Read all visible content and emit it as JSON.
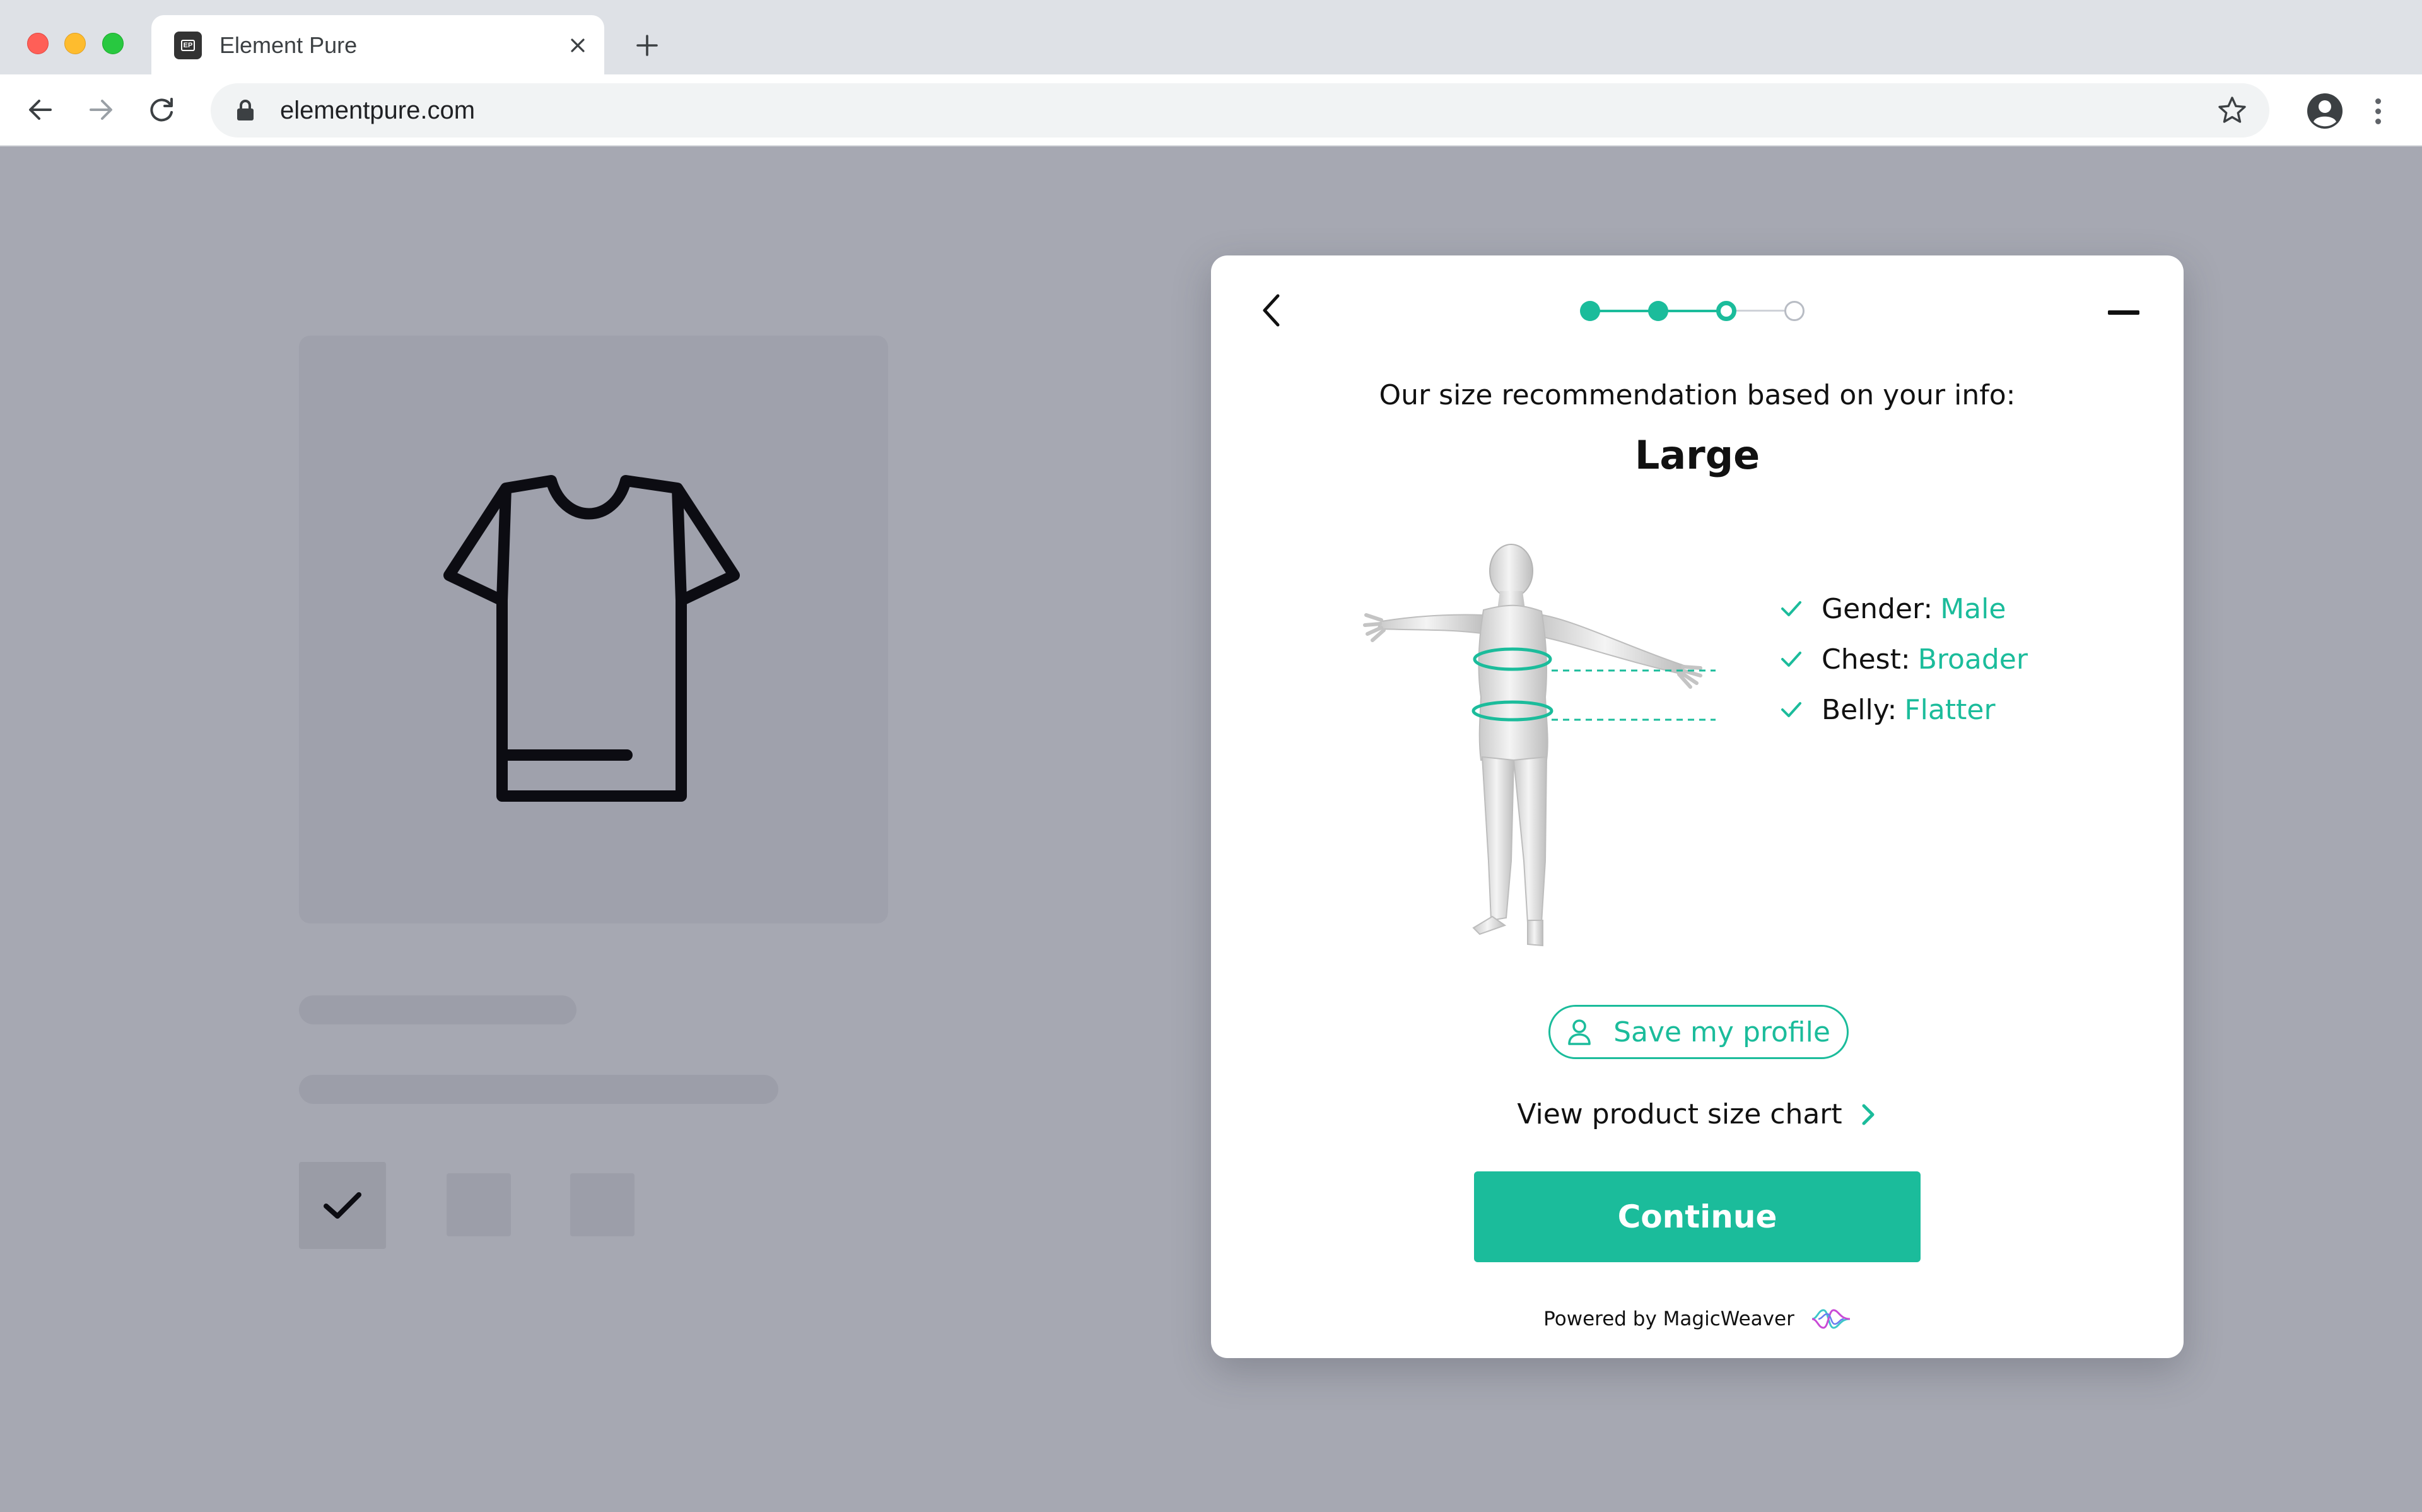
{
  "browser": {
    "tab_title": "Element Pure",
    "tab_favicon": "EP",
    "url": "elementpure.com",
    "icons": [
      "back-icon",
      "forward-icon",
      "reload-icon",
      "lock-icon",
      "star-icon",
      "profile-icon",
      "more-icon",
      "close-icon",
      "plus-icon"
    ]
  },
  "product_page": {
    "image_icon": "tshirt-icon",
    "selected_swatch_icon": "checkmark-icon"
  },
  "modal": {
    "progress": {
      "total_steps": 4,
      "completed_steps": 2,
      "current_step": 3
    },
    "heading": "Our size recommendation based on your info:",
    "recommended_size": "Large",
    "attributes": [
      {
        "key": "Gender:",
        "value": "Male"
      },
      {
        "key": "Chest:",
        "value": "Broader"
      },
      {
        "key": "Belly:",
        "value": "Flatter"
      }
    ],
    "save_profile_label": "Save my profile",
    "size_chart_label": "View product size chart",
    "continue_label": "Continue",
    "powered_by": "Powered by MagicWeaver",
    "colors": {
      "accent": "#1bbc9b",
      "overlay": "#a6a8b2"
    }
  }
}
